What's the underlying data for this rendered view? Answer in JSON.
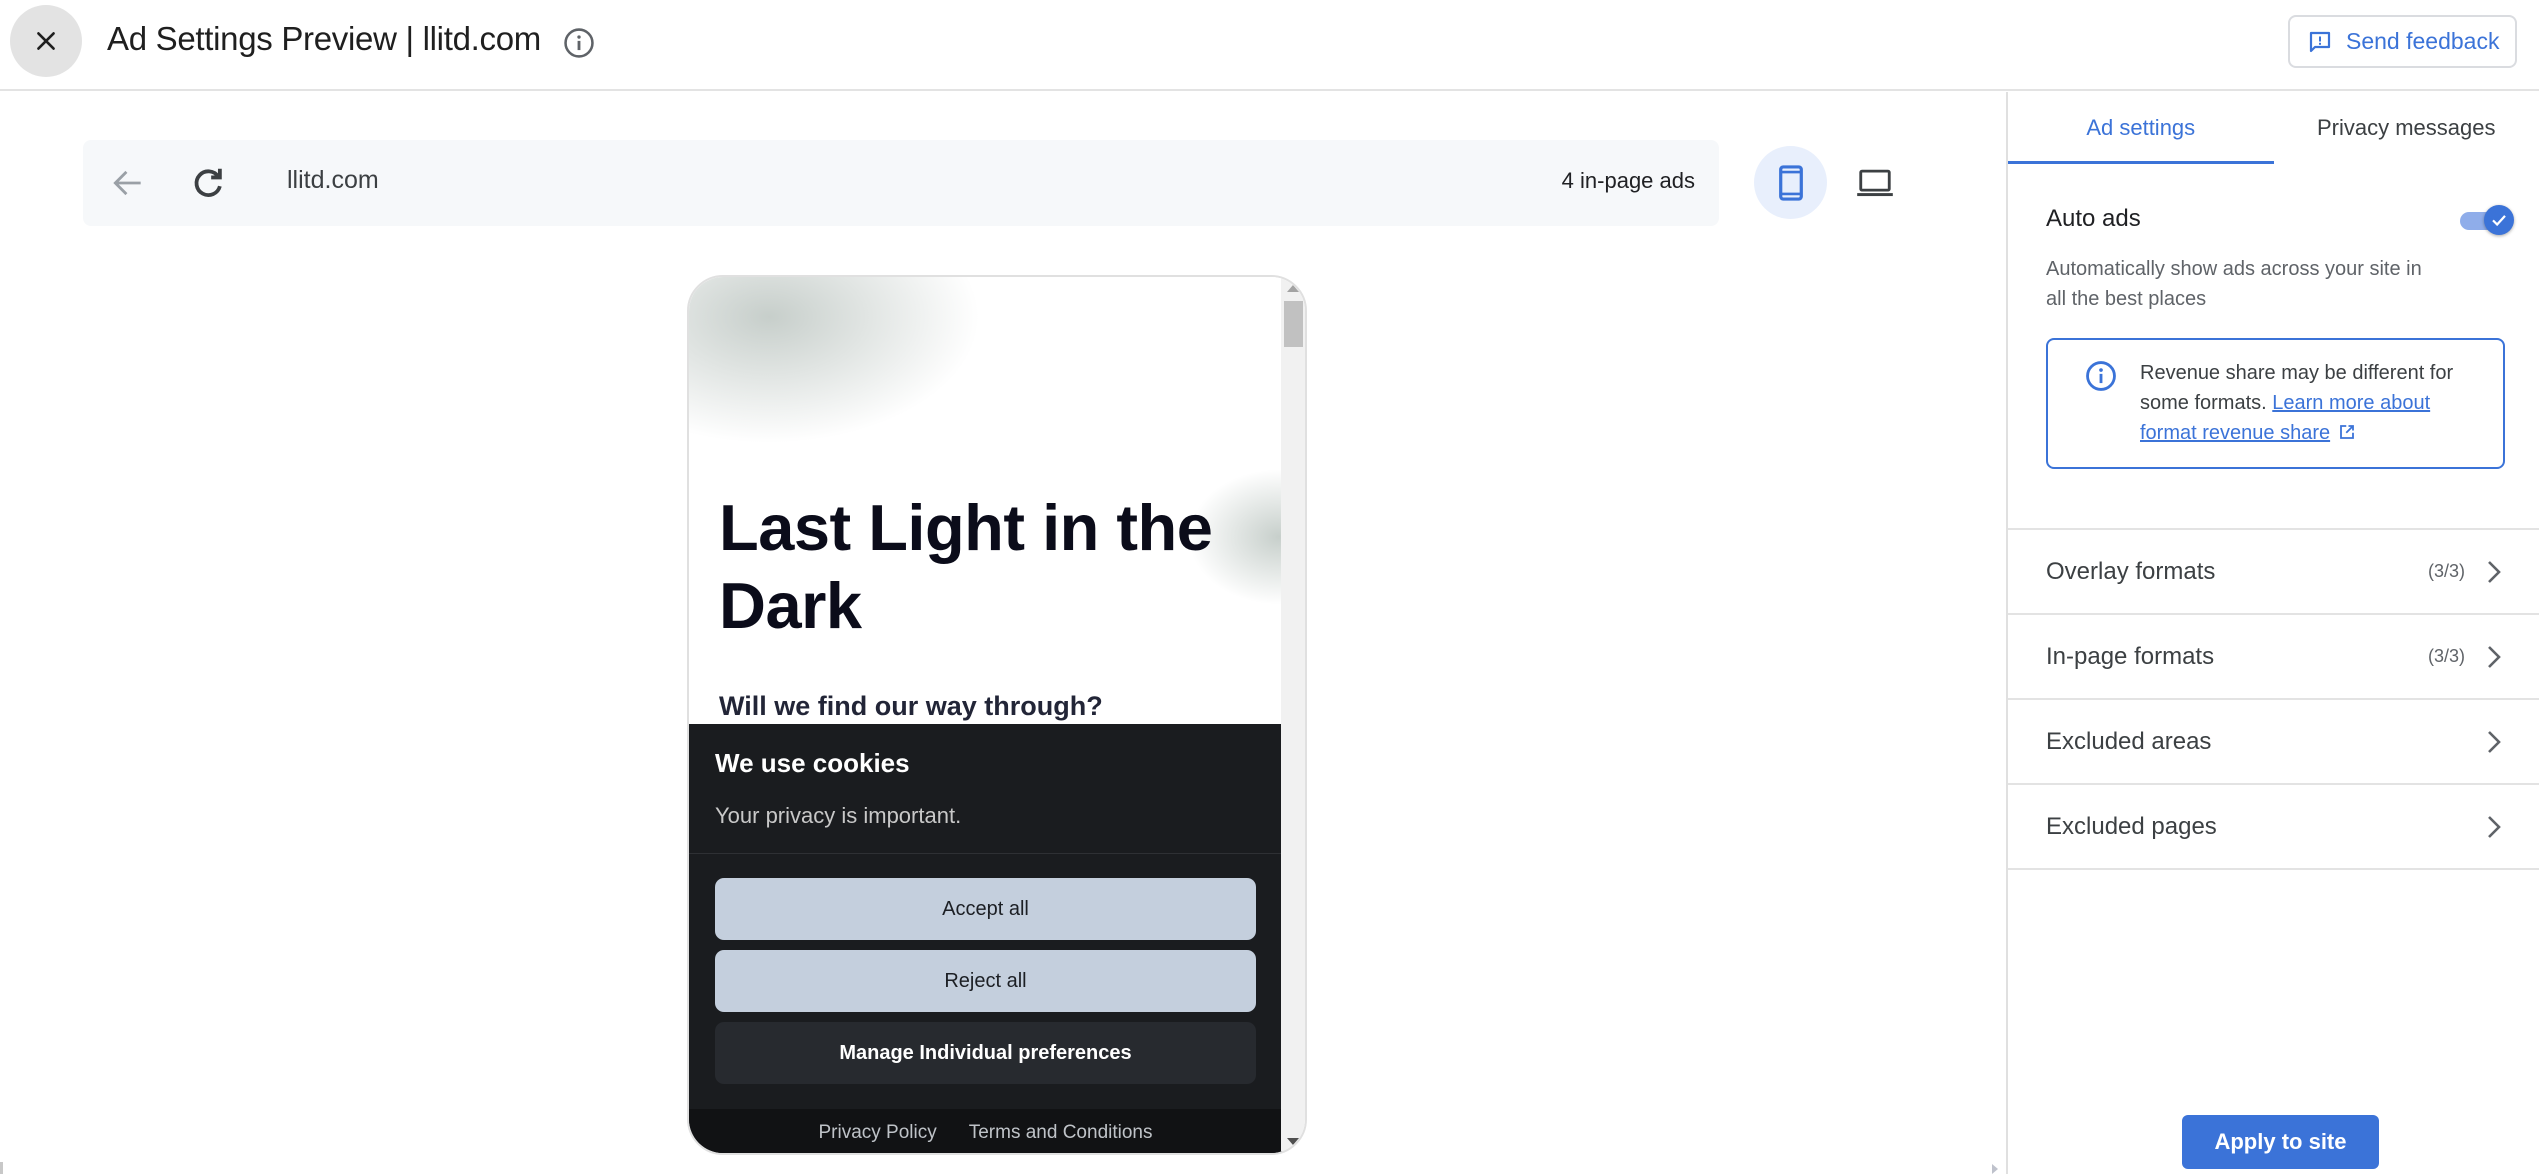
{
  "header": {
    "title": "Ad Settings Preview | llitd.com",
    "close_icon": "close-icon",
    "info_icon": "info-icon",
    "feedback_label": "Send feedback",
    "feedback_icon": "feedback-icon"
  },
  "preview": {
    "url": "llitd.com",
    "ads_count_label": "4 in-page ads",
    "back_icon": "arrow-back-icon",
    "reload_icon": "reload-icon",
    "devices": [
      {
        "name": "mobile",
        "icon": "smartphone-icon",
        "selected": true
      },
      {
        "name": "desktop",
        "icon": "laptop-icon",
        "selected": false
      }
    ],
    "page": {
      "title": "Last Light in the Dark",
      "subtitle": "Will we find our way through?"
    },
    "cookie_banner": {
      "title": "We use cookies",
      "text": "Your privacy is important.",
      "accept_label": "Accept all",
      "reject_label": "Reject all",
      "manage_label": "Manage Individual preferences",
      "footer_links": [
        "Privacy Policy",
        "Terms and Conditions"
      ]
    }
  },
  "panel": {
    "tabs": [
      {
        "label": "Ad settings",
        "active": true
      },
      {
        "label": "Privacy messages",
        "active": false
      }
    ],
    "auto_ads": {
      "label": "Auto ads",
      "enabled": true,
      "description": "Automatically show ads across your site in all the best places"
    },
    "info_box": {
      "text": "Revenue share may be different for some formats.",
      "link_label": "Learn more about format revenue share",
      "link_icon": "open-in-new-icon"
    },
    "sections": [
      {
        "label": "Overlay formats",
        "count": "(3/3)"
      },
      {
        "label": "In-page formats",
        "count": "(3/3)"
      },
      {
        "label": "Excluded areas",
        "count": ""
      },
      {
        "label": "Excluded pages",
        "count": ""
      }
    ],
    "apply_label": "Apply to site"
  },
  "colors": {
    "accent": "#3b73d8",
    "cookie_bg": "#1a1c1f",
    "cookie_button": "#c4cfdd"
  }
}
